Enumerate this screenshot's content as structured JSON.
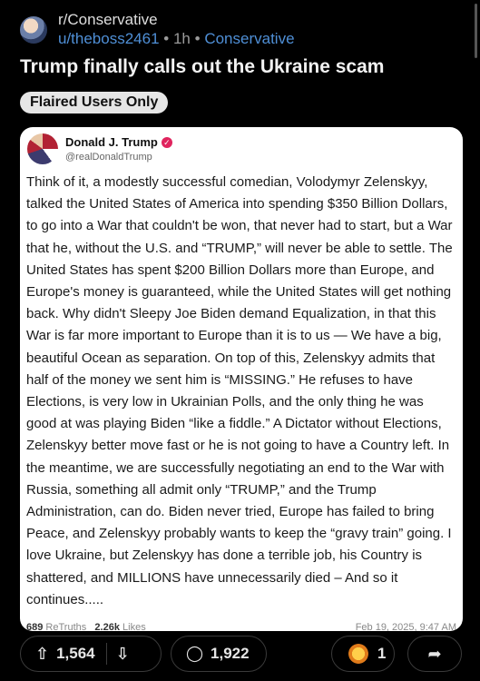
{
  "post": {
    "subreddit": "r/Conservative",
    "author": "u/theboss2461",
    "separator": "•",
    "age": "1h",
    "flair_category": "Conservative",
    "title": "Trump finally calls out the Ukraine scam",
    "flair": "Flaired Users Only"
  },
  "embed": {
    "name": "Donald J. Trump",
    "handle": "@realDonaldTrump",
    "text": "Think of it, a modestly successful comedian, Volodymyr Zelenskyy, talked the United States of America into spending $350 Billion Dollars, to go into a War that couldn't be won, that never had to start, but a War that he, without the U.S. and “TRUMP,” will never be able to settle. The United States has spent $200 Billion Dollars more than Europe, and Europe's money is guaranteed, while the United States will get nothing back. Why didn't Sleepy Joe Biden demand Equalization, in that this War is far more important to Europe than it is to us — We have a big, beautiful Ocean as separation. On top of this, Zelenskyy admits that half of the money we sent him is “MISSING.” He refuses to have Elections, is very low in Ukrainian Polls, and the only thing he was good at was playing Biden “like a fiddle.” A Dictator without Elections, Zelenskyy better move fast or he is not going to have a Country left. In the meantime, we are successfully negotiating an end to the War with Russia, something all admit only “TRUMP,” and the Trump Administration, can do. Biden never tried, Europe has failed to bring Peace, and Zelenskyy probably wants to keep the “gravy train” going. I love Ukraine, but Zelenskyy has done a terrible job, his Country is shattered, and MILLIONS have unnecessarily died – And so it continues.....",
    "retruths_count": "689",
    "retruths_label": "ReTruths",
    "likes_count": "2.26k",
    "likes_label": "Likes",
    "date": "Feb 19, 2025, 9:47 AM"
  },
  "actions": {
    "upvotes": "1,564",
    "comments": "1,922",
    "awards": "1",
    "icons": {
      "upvote": "⇧",
      "downvote": "⇩",
      "comment": "◯",
      "share": "➦"
    }
  }
}
